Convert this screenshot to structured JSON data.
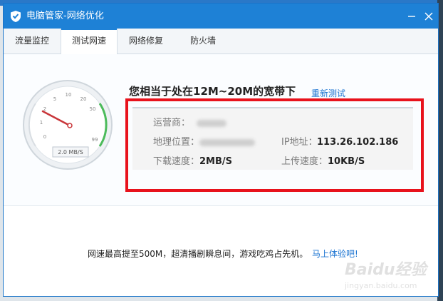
{
  "window": {
    "title": "电脑管家-网络优化"
  },
  "tabs": [
    {
      "label": "流量监控",
      "active": false
    },
    {
      "label": "测试网速",
      "active": true
    },
    {
      "label": "网络修复",
      "active": false
    },
    {
      "label": "防火墙",
      "active": false
    }
  ],
  "gauge": {
    "ticks": [
      "0",
      "1",
      "2",
      "5",
      "10",
      "20",
      "50",
      "99"
    ],
    "readout": "2.0 MB/S",
    "colors": {
      "ring": "#cfd6dc",
      "needle": "#c9363a",
      "arc": "#4cbb5b"
    }
  },
  "result": {
    "headline": "您相当于处在12M~20M的宽带下",
    "retest_label": "重新测试",
    "isp_label": "运营商：",
    "location_label": "地理位置：",
    "ip_label": "IP地址：",
    "ip_value": "113.26.102.186",
    "download_label": "下载速度：",
    "download_value": "2MB/S",
    "upload_label": "上传速度：",
    "upload_value": "10KB/S"
  },
  "promo": {
    "text": "网速最高提至500M，超清播剧瞬息间，游戏吃鸡占先机。",
    "link": "马上体验吧!"
  },
  "watermark": {
    "text": "Baidu经验",
    "sub": "jingyan.baidu.com"
  },
  "colors": {
    "titlebar": "#1e81d6",
    "link": "#1a73d1",
    "highlight_border": "#e8121c"
  }
}
